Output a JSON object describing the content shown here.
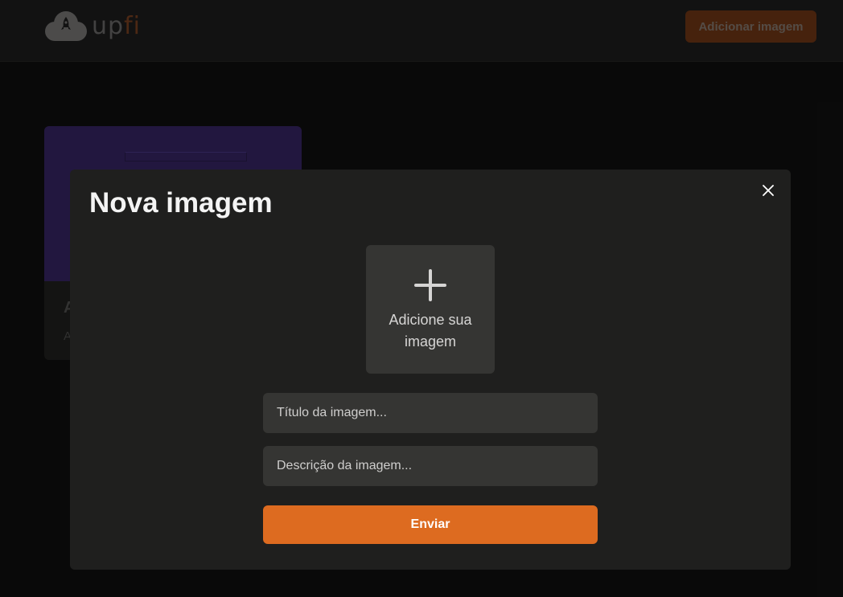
{
  "header": {
    "logo_text_up": "up",
    "logo_text_fi": "fi",
    "add_image_label": "Adicionar imagem"
  },
  "card": {
    "title": "A",
    "description": "A"
  },
  "modal": {
    "title": "Nova imagem",
    "upload_label": "Adicione sua imagem",
    "title_placeholder": "Título da imagem...",
    "description_placeholder": "Descrição da imagem...",
    "submit_label": "Enviar",
    "close_icon": "close-icon",
    "upload_icon": "plus-icon"
  },
  "colors": {
    "accent": "#dd6b20",
    "modal_bg": "#1f1f1e",
    "input_bg": "#353533",
    "card_image": "#3e2a73"
  }
}
